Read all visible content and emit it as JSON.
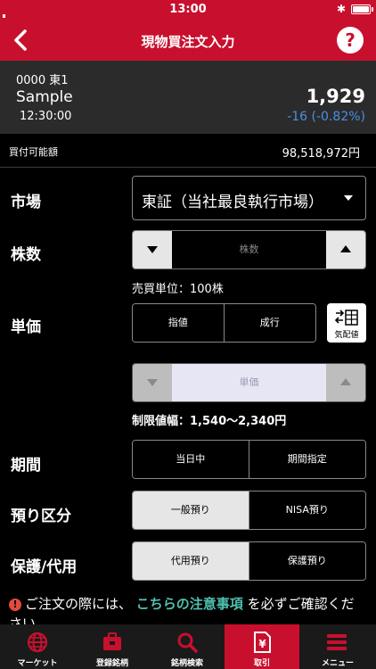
{
  "status": {
    "time": "13:00"
  },
  "nav": {
    "title": "現物買注文入力",
    "help": "?"
  },
  "quote": {
    "code": "0000 東1",
    "name": "Sample",
    "time": "12:30:00",
    "price": "1,929",
    "change": "-16 (-0.82%)"
  },
  "funds": {
    "label": "買付可能額",
    "value": "98,518,972円"
  },
  "market": {
    "label": "市場",
    "selected": "東証（当社最良執行市場）"
  },
  "shares": {
    "label": "株数",
    "placeholder": "株数",
    "unit_note": "売買単位：100株"
  },
  "price": {
    "label": "単価",
    "options": [
      "指値",
      "成行"
    ],
    "kehai_label": "気配値",
    "placeholder": "単価",
    "limit_note": "制限値幅：1,540〜2,340円"
  },
  "period": {
    "label": "期間",
    "options": [
      "当日中",
      "期間指定"
    ]
  },
  "account": {
    "label": "預り区分",
    "options": [
      "一般預り",
      "NISA預り"
    ]
  },
  "custody": {
    "label": "保護/代用",
    "options": [
      "代用預り",
      "保護預り"
    ]
  },
  "warning": {
    "prefix": "ご注文の際には、",
    "link": "こちらの注意事項",
    "suffix": "を必ずご確認ください。"
  },
  "tabs": [
    {
      "label": "マーケット",
      "icon": "globe-icon"
    },
    {
      "label": "登録銘柄",
      "icon": "briefcase-icon"
    },
    {
      "label": "銘柄検索",
      "icon": "search-icon"
    },
    {
      "label": "取引",
      "icon": "yen-document-icon"
    },
    {
      "label": "メニュー",
      "icon": "menu-icon"
    }
  ],
  "colors": {
    "brand": "#c8102e",
    "negative_change": "#4a90e2",
    "link": "#4fc1b0",
    "warning_icon": "#e24a3b"
  }
}
